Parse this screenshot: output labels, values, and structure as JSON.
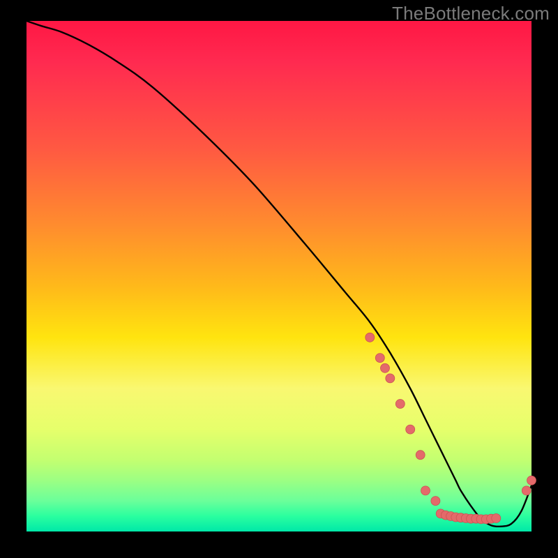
{
  "watermark": "TheBottleneck.com",
  "colors": {
    "bg": "#000000",
    "curve": "#000000",
    "dot_fill": "#e46a6a",
    "dot_stroke": "#c95454",
    "watermark": "#7b7b7b"
  },
  "chart_data": {
    "type": "line",
    "title": "",
    "xlabel": "",
    "ylabel": "",
    "xlim": [
      0,
      100
    ],
    "ylim": [
      0,
      100
    ],
    "grid": false,
    "legend": false,
    "x": [
      0,
      3,
      7,
      12,
      18,
      25,
      35,
      45,
      55,
      63,
      68,
      72,
      76,
      79,
      81,
      83,
      85,
      86,
      88,
      90,
      92,
      94,
      96,
      98,
      100
    ],
    "values": [
      100,
      99,
      97.8,
      95.5,
      92,
      87,
      78,
      68,
      56.5,
      47,
      41,
      35,
      28,
      22,
      18,
      14,
      10,
      8,
      5,
      2.5,
      1.2,
      1,
      1.5,
      4,
      9
    ],
    "scatter_color": "#e46a6a",
    "scatter": [
      {
        "x": 68,
        "y": 38
      },
      {
        "x": 70,
        "y": 34
      },
      {
        "x": 71,
        "y": 32
      },
      {
        "x": 72,
        "y": 30
      },
      {
        "x": 74,
        "y": 25
      },
      {
        "x": 76,
        "y": 20
      },
      {
        "x": 78,
        "y": 15
      },
      {
        "x": 79,
        "y": 8
      },
      {
        "x": 81,
        "y": 6
      },
      {
        "x": 82,
        "y": 3.5
      },
      {
        "x": 83,
        "y": 3.2
      },
      {
        "x": 84,
        "y": 3
      },
      {
        "x": 85,
        "y": 2.8
      },
      {
        "x": 86,
        "y": 2.7
      },
      {
        "x": 87,
        "y": 2.6
      },
      {
        "x": 88,
        "y": 2.5
      },
      {
        "x": 89,
        "y": 2.5
      },
      {
        "x": 90,
        "y": 2.4
      },
      {
        "x": 91,
        "y": 2.4
      },
      {
        "x": 92,
        "y": 2.5
      },
      {
        "x": 93,
        "y": 2.6
      },
      {
        "x": 99,
        "y": 8
      },
      {
        "x": 100,
        "y": 10
      }
    ]
  }
}
